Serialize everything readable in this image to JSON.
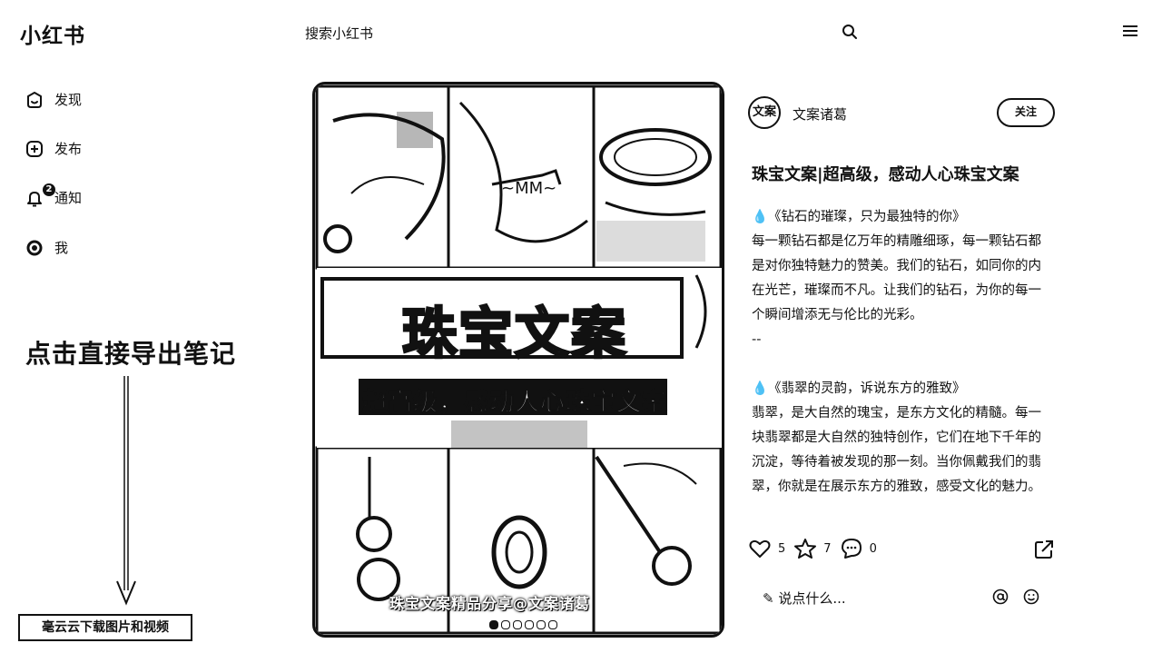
{
  "header": {
    "logo": "小红书",
    "search_placeholder": "搜索小红书"
  },
  "sidebar": {
    "items": [
      {
        "label": "发现",
        "icon": "home-icon"
      },
      {
        "label": "发布",
        "icon": "plus-icon"
      },
      {
        "label": "通知",
        "icon": "bell-icon",
        "badge": "2"
      },
      {
        "label": "我",
        "icon": "avatar-icon"
      }
    ]
  },
  "annotation": {
    "text": "点击直接导出笔记",
    "download_button": "毫云云下载图片和视频"
  },
  "cover": {
    "title": "珠宝文案",
    "subtitle": "超高级，感动人心珠宝文案",
    "caption": "珠宝文案精品分享@文案诸葛",
    "dots_total": 6,
    "dots_active": 1
  },
  "note": {
    "author": "文案诸葛",
    "avatar_text": "文案",
    "follow_label": "关注",
    "title": "珠宝文案|超高级，感动人心珠宝文案",
    "paragraphs": [
      "💧《钻石的璀璨，只为最独特的你》",
      "每一颗钻石都是亿万年的精雕细琢，每一颗钻石都是对你独特魅力的赞美。我们的钻石，如同你的内在光芒，璀璨而不凡。让我们的钻石，为你的每一个瞬间增添无与伦比的光彩。",
      "--",
      "",
      "💧《翡翠的灵韵，诉说东方的雅致》",
      "翡翠，是大自然的瑰宝，是东方文化的精髓。每一块翡翠都是大自然的独特创作，它们在地下千年的沉淀，等待着被发现的那一刻。当你佩戴我们的翡翠，你就是在展示东方的雅致，感受文化的魅力。"
    ],
    "likes": "5",
    "collects": "7",
    "comments": "0",
    "comment_placeholder": "说点什么..."
  }
}
